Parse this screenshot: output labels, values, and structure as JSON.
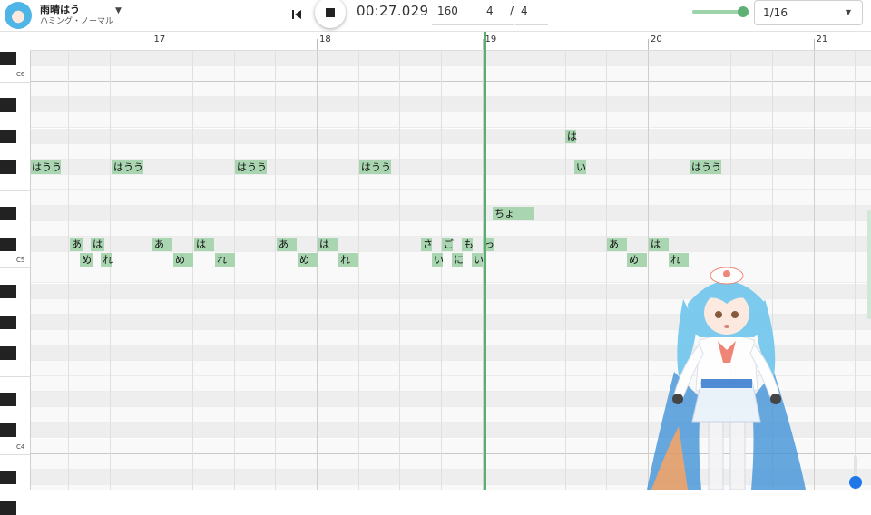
{
  "header": {
    "singer_name": "雨晴はう",
    "singer_style": "ハミング・ノーマル",
    "time": "00:27.029",
    "tempo": "160",
    "beats": "4",
    "slash": "/",
    "beat_type": "4",
    "snap": "1/16",
    "volume_level": 0.9
  },
  "ruler": {
    "bars": [
      "17",
      "18",
      "19",
      "20",
      "21"
    ]
  },
  "keyboard": {
    "labels": [
      "C6",
      "C5",
      "C4"
    ]
  },
  "notes": [
    "はうう",
    "はうう",
    "はうう",
    "はうう",
    "はうう",
    "は",
    "い",
    "ちょ",
    "あ",
    "は",
    "め",
    "れ",
    "あ",
    "は",
    "め",
    "れ",
    "あ",
    "は",
    "め",
    "れ",
    "さ",
    "ご",
    "も",
    "っ",
    "い",
    "に",
    "い",
    "あ",
    "は",
    "め",
    "れ"
  ],
  "icons": {
    "rewind": "skip-previous-icon",
    "stop": "stop-icon",
    "dropdown": "chevron-down-icon"
  },
  "colors": {
    "note": "#a9d5b1",
    "playhead": "#57b06e",
    "accent": "#5fb173",
    "volume": "#1e78e8"
  }
}
